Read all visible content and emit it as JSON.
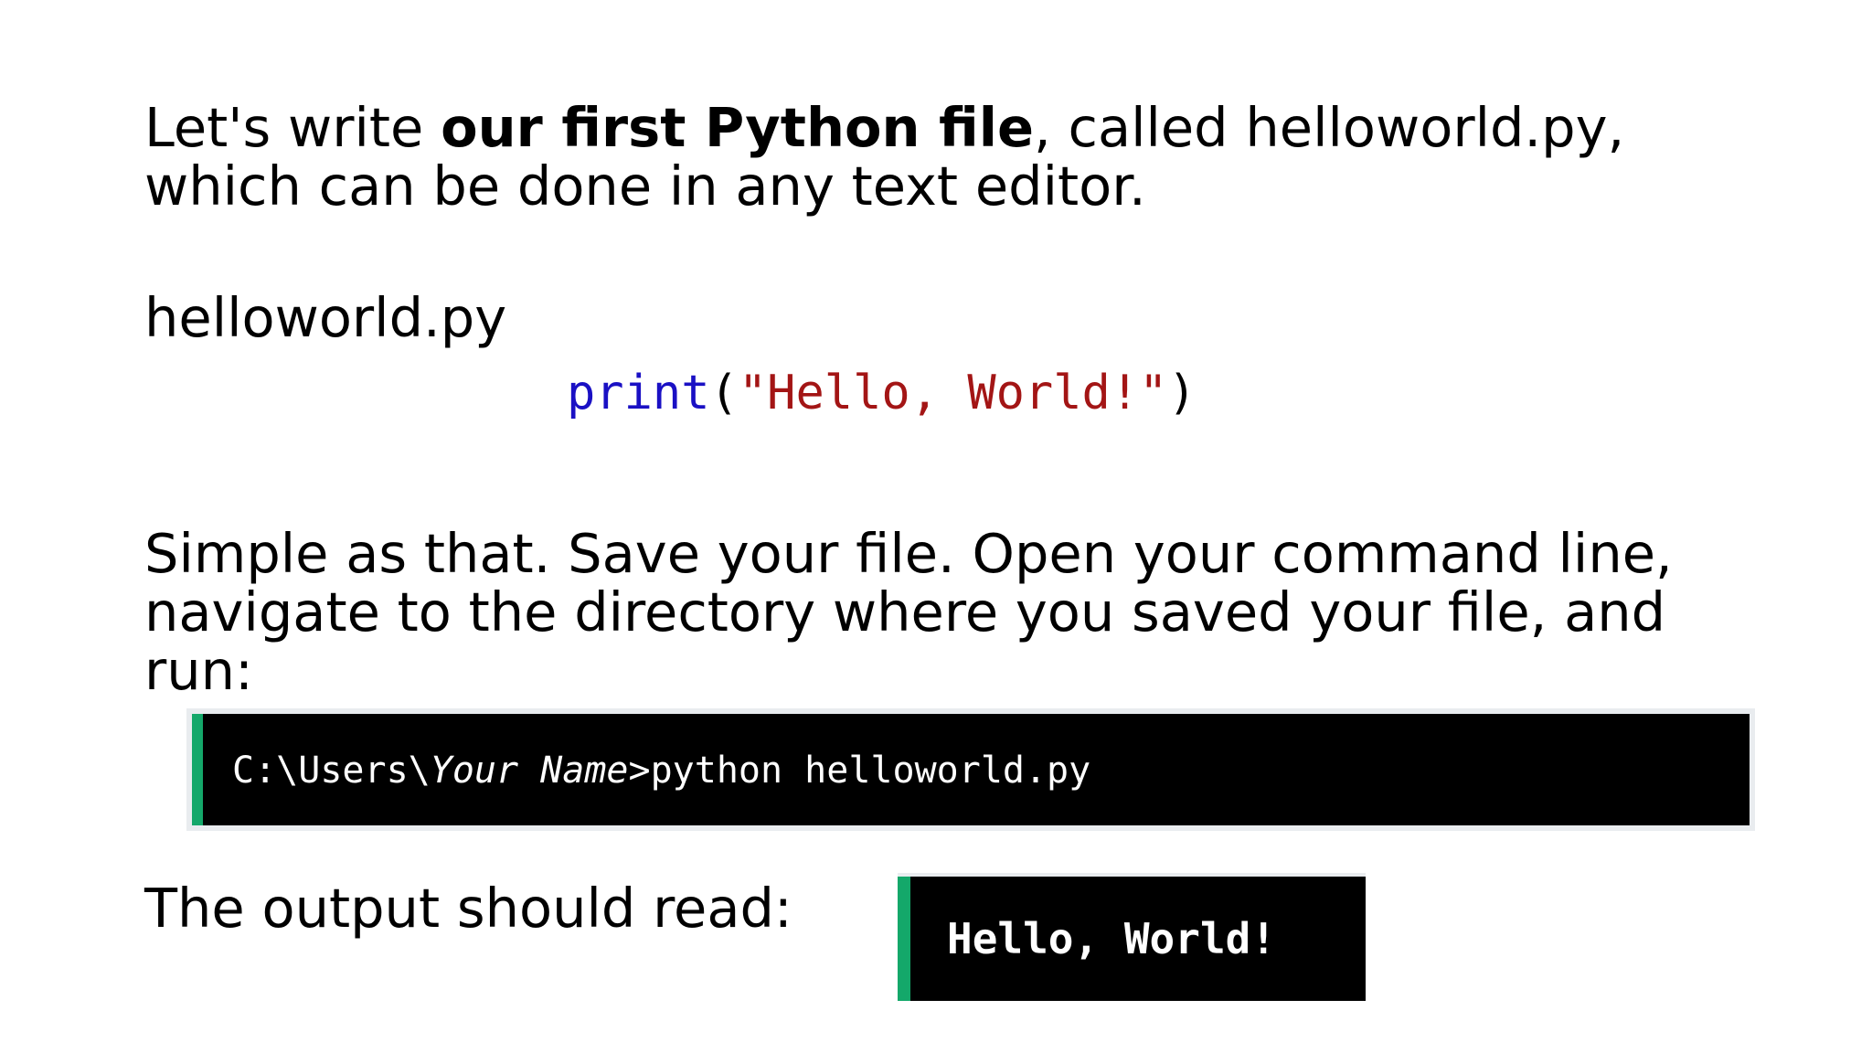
{
  "intro": {
    "part1": "Let's write ",
    "bold": "our first Python file",
    "part2": ", called helloworld.py,",
    "line2": "which can be done in any text editor."
  },
  "filename": "helloworld.py",
  "code": {
    "keyword": "print",
    "open_paren": "(",
    "string": "\"Hello, World!\"",
    "close_paren": ")"
  },
  "instructions": {
    "line1": "Simple as that. Save your file. Open your command line,",
    "line2": "navigate to the directory where you saved your file, and",
    "line3": "run:"
  },
  "command": {
    "prefix": "C:\\Users\\",
    "italic": "Your Name",
    "suffix": ">python helloworld.py"
  },
  "output_label": "The output should read:",
  "output_text": "Hello, World!",
  "colors": {
    "keyword": "#1a10c4",
    "string": "#a31515",
    "terminal_accent": "#14a86a",
    "terminal_bg": "#000000"
  }
}
